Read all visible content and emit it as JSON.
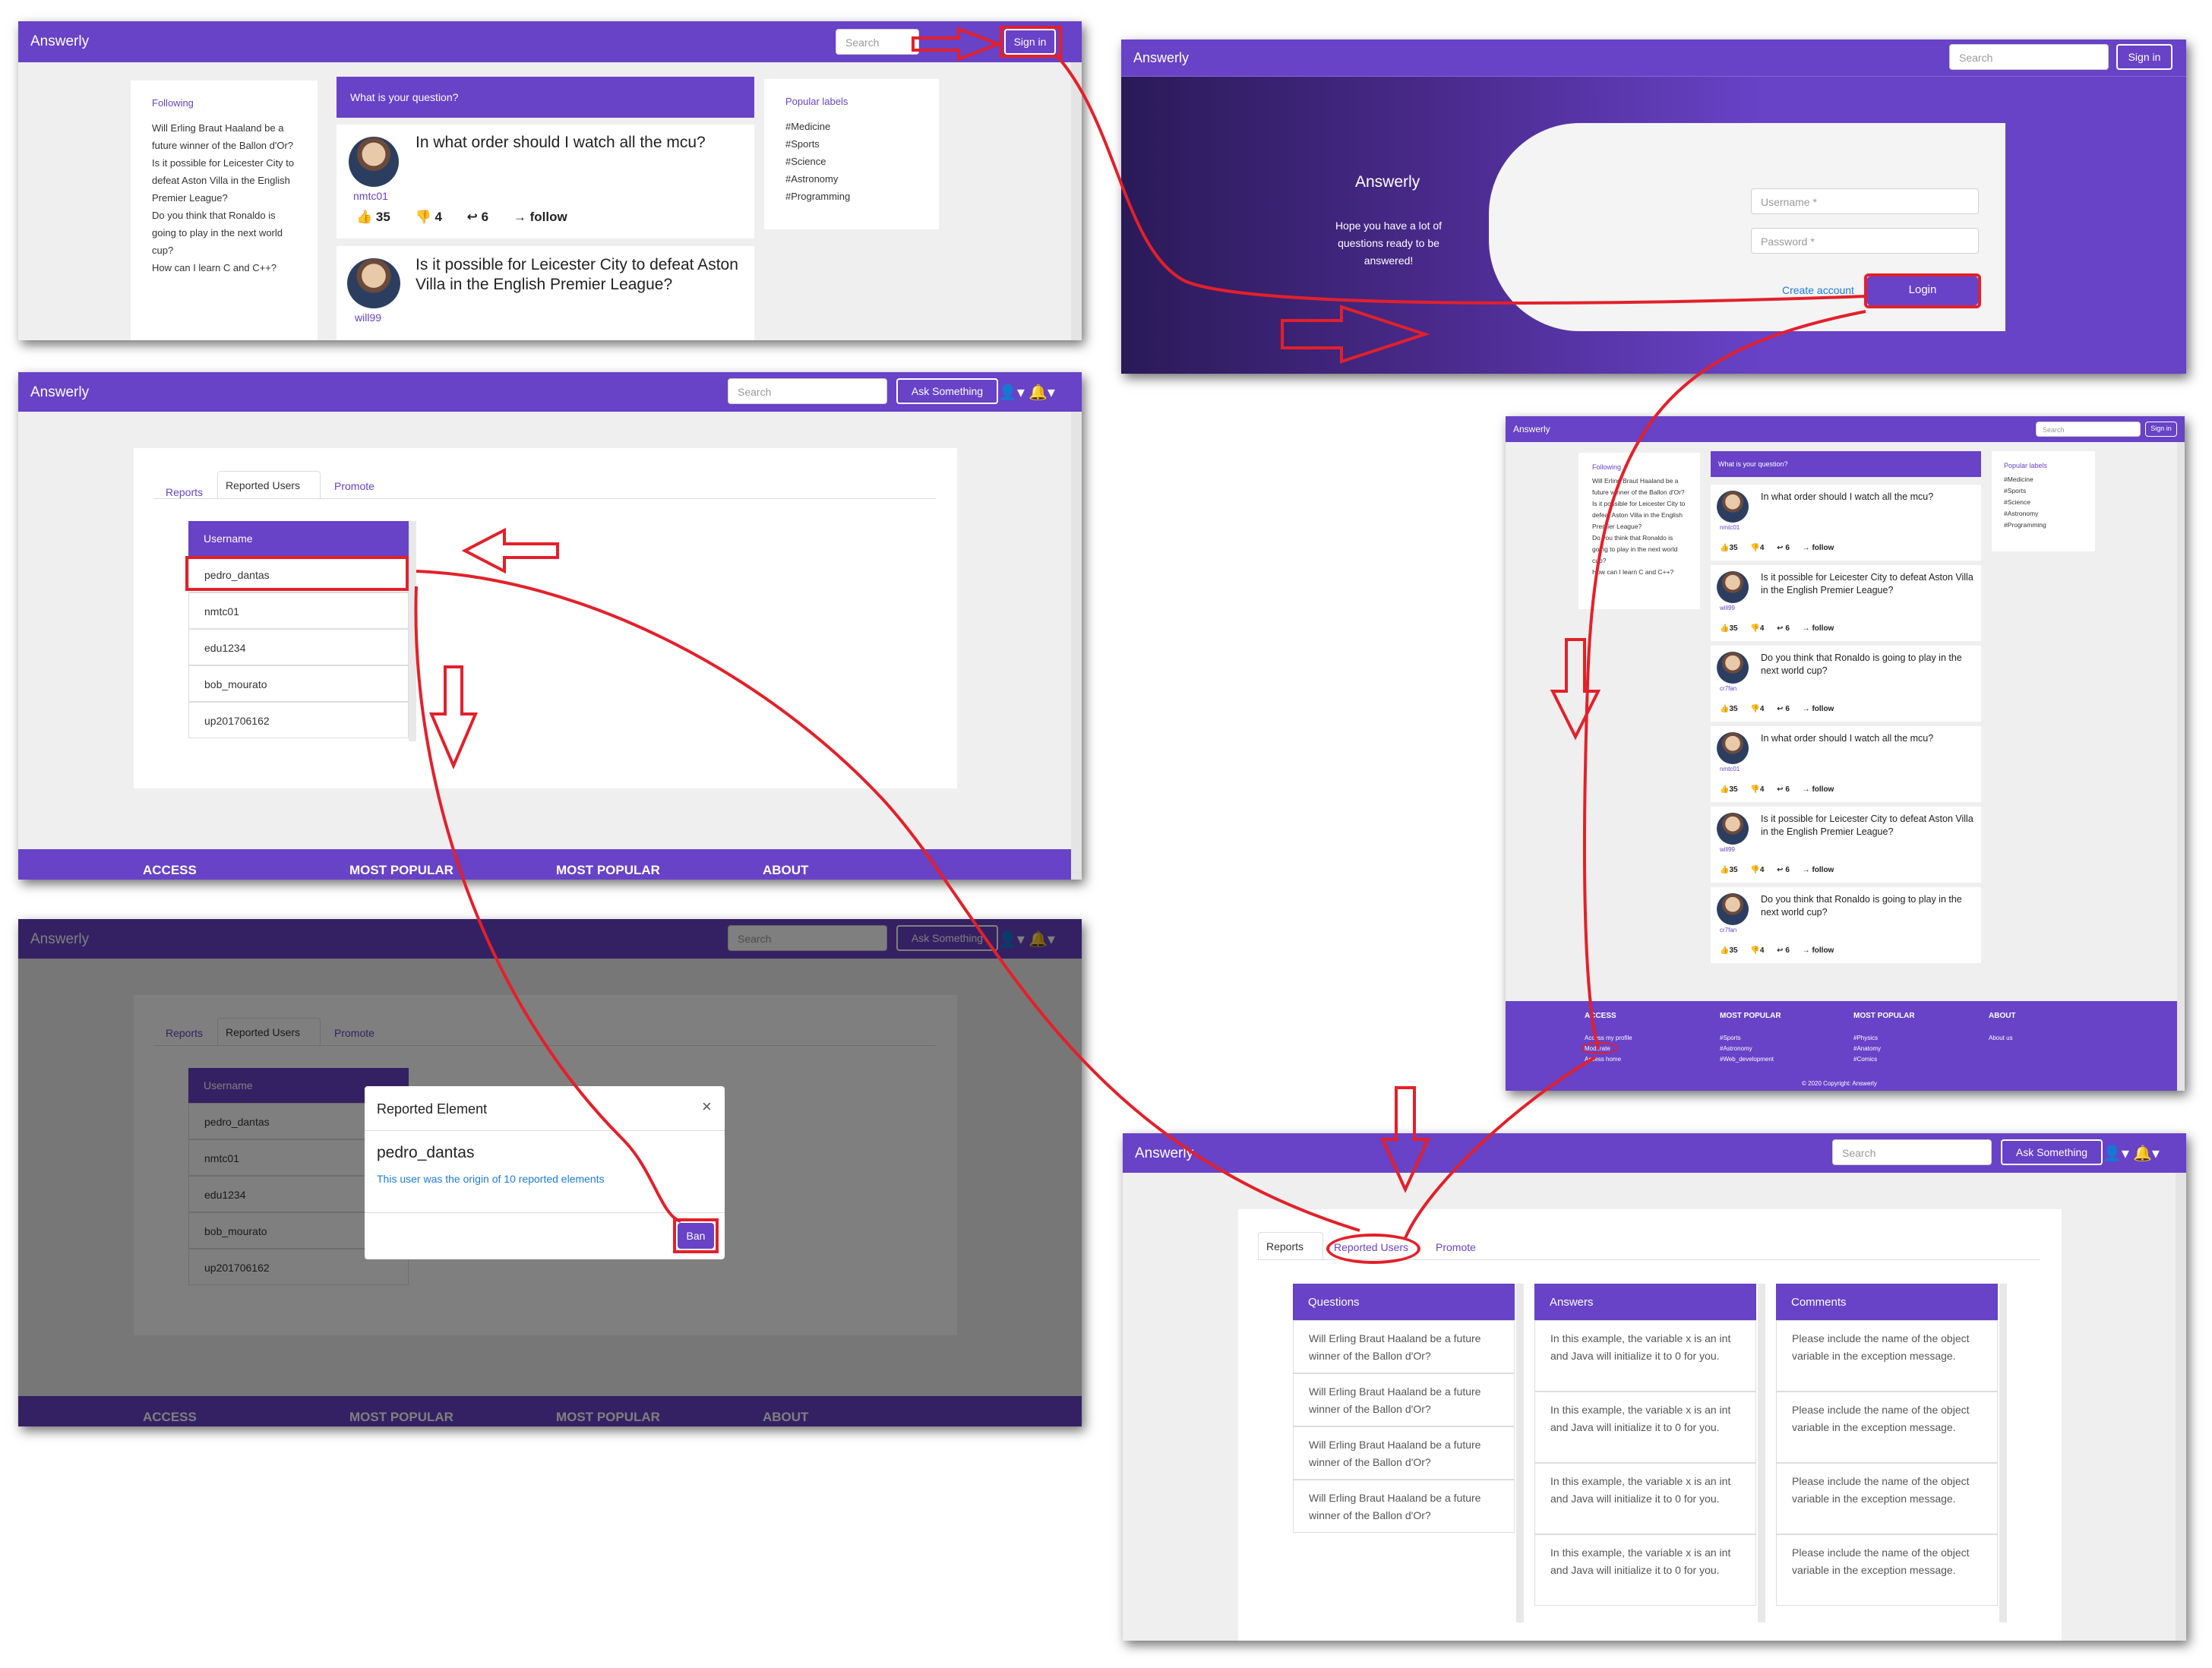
{
  "brand": "Answerly",
  "search_placeholder": "Search",
  "sign_in": "Sign in",
  "ask_something": "Ask Something",
  "home": {
    "question_placeholder": "What is your question?",
    "following_title": "Following",
    "following_items": [
      "Will Erling Braut Haaland be a future winner of the Ballon d'Or?",
      "Is it possible for Leicester City to defeat Aston Villa in the English Premier League?",
      "Do you think that Ronaldo is going to play in the next world cup?",
      "How can I learn C and C++?"
    ],
    "labels_title": "Popular labels",
    "labels": [
      "#Medicine",
      "#Sports",
      "#Science",
      "#Astronomy",
      "#Programming"
    ],
    "questions": [
      {
        "title": "In what order should I watch all the mcu?",
        "user": "nmtc01"
      },
      {
        "title": "Is it possible for Leicester City to defeat Aston Villa in the English Premier League?",
        "user": "will99"
      },
      {
        "title": "Do you think that Ronaldo is going to play in the next world cup?",
        "user": "cr7fan"
      },
      {
        "title": "In what order should I watch all the mcu?",
        "user": "nmtc01"
      },
      {
        "title": "Is it possible for Leicester City to defeat Aston Villa in the English Premier League?",
        "user": "will99"
      },
      {
        "title": "Do you think that Ronaldo is going to play in the next world cup?",
        "user": "cr7fan"
      }
    ],
    "stats": {
      "likes": "35",
      "dislikes": "4",
      "answers": "6",
      "follow": "follow"
    }
  },
  "login": {
    "title": "Answerly",
    "subtitle": "Hope you have a lot of questions ready to be answered!",
    "username_placeholder": "Username *",
    "password_placeholder": "Password *",
    "create_account": "Create account",
    "login_button": "Login"
  },
  "footer": {
    "headings": [
      "ACCESS",
      "MOST POPULAR",
      "MOST POPULAR",
      "ABOUT"
    ],
    "access_links": [
      "Access my profile",
      "Moderate",
      "Access home"
    ],
    "popular1": [
      "#Sports",
      "#Astronomy",
      "#Web_development"
    ],
    "popular2": [
      "#Physics",
      "#Anatomy",
      "#Comics"
    ],
    "about": [
      "About us"
    ],
    "copyright": "© 2020 Copyright: Answerly"
  },
  "moderation": {
    "tabs": [
      "Reports",
      "Reported Users",
      "Promote"
    ],
    "username_header": "Username",
    "users": [
      "pedro_dantas",
      "nmtc01",
      "edu1234",
      "bob_mourato",
      "up201706162"
    ],
    "columns": [
      "Questions",
      "Answers",
      "Comments"
    ],
    "question_text": "Will Erling Braut Haaland be a future winner of the Ballon d'Or?",
    "answer_text": "In this example, the variable x is an int and Java will initialize it to 0 for you.",
    "comment_text": "Please include the name of the object variable in the exception message."
  },
  "modal": {
    "title": "Reported Element",
    "close": "×",
    "username": "pedro_dantas",
    "message": "This user was the origin of 10 reported elements",
    "ban": "Ban"
  },
  "colors": {
    "primary": "#6842c7",
    "annotation": "#e3202a"
  }
}
